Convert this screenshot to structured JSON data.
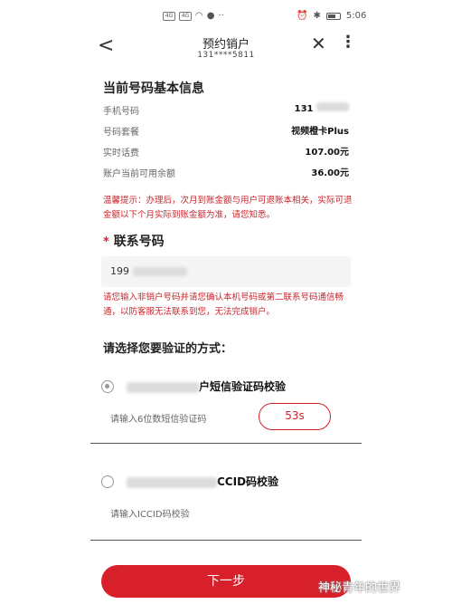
{
  "status": {
    "time": "5:06",
    "signal_a": "4G",
    "signal_b": "4G"
  },
  "header": {
    "title": "预约销户",
    "subtitle": "131****5811"
  },
  "info": {
    "title": "当前号码基本信息",
    "rows": [
      {
        "label": "手机号码",
        "value": "131"
      },
      {
        "label": "号码套餐",
        "value": "视频橙卡Plus"
      },
      {
        "label": "实时话费",
        "value": "107.00元"
      },
      {
        "label": "账户当前可用余额",
        "value": "36.00元"
      }
    ]
  },
  "warning": "温馨提示：办理后，次月到账金额与用户可退账本相关，实际可退金额以下个月实际到账金额为准，请您知悉。",
  "contact": {
    "title": "联系号码",
    "required_mark": "*",
    "value": "199",
    "note": "请您输入非销户号码并请您确认本机号码或第二联系号码通信畅通，以防客服无法联系到您，无法完成销户。"
  },
  "verify": {
    "prompt": "请选择您要验证的方式：",
    "options": [
      {
        "label": "户短信验证码校验",
        "hint": "请输入6位数短信验证码",
        "checked": true
      },
      {
        "label": "CCID码校验",
        "hint": "请输入ICCID码校验",
        "checked": false
      }
    ],
    "countdown": "53s"
  },
  "next_button": "下一步",
  "watermark": "神秘青年的世界",
  "colors": {
    "accent": "#d8202a",
    "warning": "#c8252c"
  }
}
